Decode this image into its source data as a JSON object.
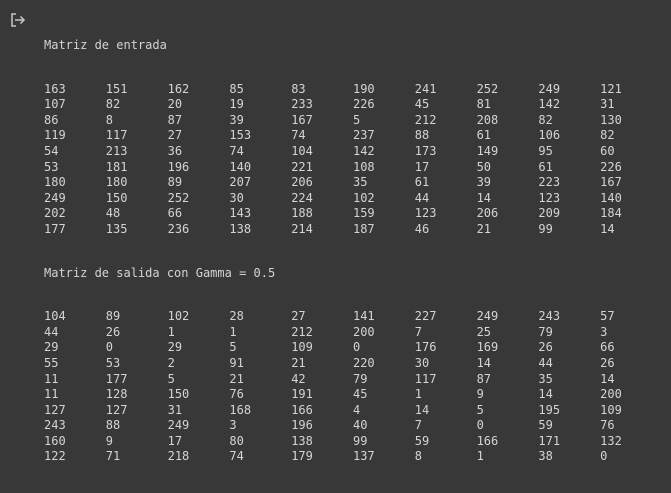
{
  "output": {
    "icon": "output-redirect-icon",
    "input_title": "Matriz de entrada",
    "input_matrix": [
      [
        "163",
        "151",
        "162",
        "85",
        "83",
        "190",
        "241",
        "252",
        "249",
        "121"
      ],
      [
        "107",
        "82",
        "20",
        "19",
        "233",
        "226",
        "45",
        "81",
        "142",
        "31"
      ],
      [
        "86",
        "8",
        "87",
        "39",
        "167",
        "5",
        "212",
        "208",
        "82",
        "130"
      ],
      [
        "119",
        "117",
        "27",
        "153",
        "74",
        "237",
        "88",
        "61",
        "106",
        "82"
      ],
      [
        "54",
        "213",
        "36",
        "74",
        "104",
        "142",
        "173",
        "149",
        "95",
        "60"
      ],
      [
        "53",
        "181",
        "196",
        "140",
        "221",
        "108",
        "17",
        "50",
        "61",
        "226"
      ],
      [
        "180",
        "180",
        "89",
        "207",
        "206",
        "35",
        "61",
        "39",
        "223",
        "167"
      ],
      [
        "249",
        "150",
        "252",
        "30",
        "224",
        "102",
        "44",
        "14",
        "123",
        "140"
      ],
      [
        "202",
        "48",
        "66",
        "143",
        "188",
        "159",
        "123",
        "206",
        "209",
        "184"
      ],
      [
        "177",
        "135",
        "236",
        "138",
        "214",
        "187",
        "46",
        "21",
        "99",
        "14"
      ]
    ],
    "output_title": "Matriz de salida con Gamma = 0.5",
    "output_matrix": [
      [
        "104",
        "89",
        "102",
        "28",
        "27",
        "141",
        "227",
        "249",
        "243",
        "57"
      ],
      [
        "44",
        "26",
        "1",
        "1",
        "212",
        "200",
        "7",
        "25",
        "79",
        "3"
      ],
      [
        "29",
        "0",
        "29",
        "5",
        "109",
        "0",
        "176",
        "169",
        "26",
        "66"
      ],
      [
        "55",
        "53",
        "2",
        "91",
        "21",
        "220",
        "30",
        "14",
        "44",
        "26"
      ],
      [
        "11",
        "177",
        "5",
        "21",
        "42",
        "79",
        "117",
        "87",
        "35",
        "14"
      ],
      [
        "11",
        "128",
        "150",
        "76",
        "191",
        "45",
        "1",
        "9",
        "14",
        "200"
      ],
      [
        "127",
        "127",
        "31",
        "168",
        "166",
        "4",
        "14",
        "5",
        "195",
        "109"
      ],
      [
        "243",
        "88",
        "249",
        "3",
        "196",
        "40",
        "7",
        "0",
        "59",
        "76"
      ],
      [
        "160",
        "9",
        "17",
        "80",
        "138",
        "99",
        "59",
        "166",
        "171",
        "132"
      ],
      [
        "122",
        "71",
        "218",
        "74",
        "179",
        "137",
        "8",
        "1",
        "38",
        "0"
      ]
    ]
  }
}
